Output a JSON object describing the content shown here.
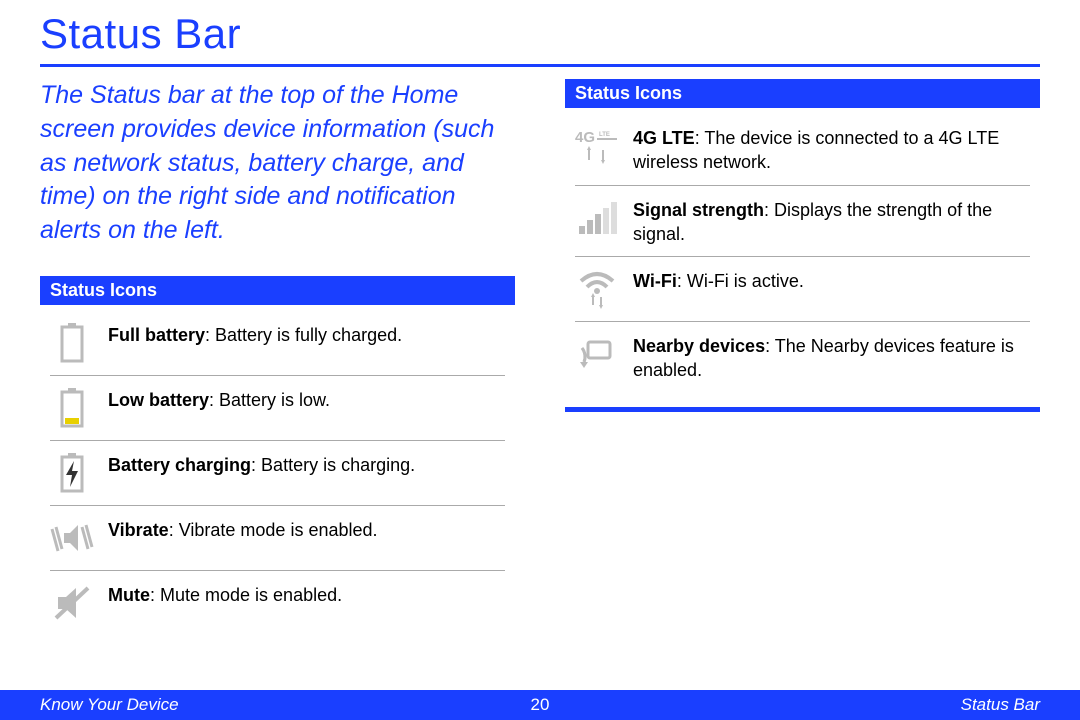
{
  "title": "Status Bar",
  "intro": "The Status bar at the top of the Home screen provides device information (such as network status, battery charge, and time) on the right side and notification alerts on the left.",
  "left": {
    "header": "Status Icons",
    "items": [
      {
        "term": "Full battery",
        "desc": ": Battery is fully charged."
      },
      {
        "term": "Low battery",
        "desc": ": Battery is low."
      },
      {
        "term": "Battery charging",
        "desc": ": Battery is charging."
      },
      {
        "term": "Vibrate",
        "desc": ": Vibrate mode is enabled."
      },
      {
        "term": "Mute",
        "desc": ": Mute mode is enabled."
      }
    ]
  },
  "right": {
    "header": "Status Icons",
    "items": [
      {
        "term": "4G LTE",
        "desc": ": The device is connected to a 4G LTE wireless network."
      },
      {
        "term": "Signal strength",
        "desc": ": Displays the strength of the signal."
      },
      {
        "term": "Wi-Fi",
        "desc": ": Wi-Fi is active."
      },
      {
        "term": "Nearby devices",
        "desc": ": The Nearby devices feature is enabled."
      }
    ]
  },
  "footer": {
    "left": "Know Your Device",
    "page": "20",
    "right": "Status Bar"
  }
}
